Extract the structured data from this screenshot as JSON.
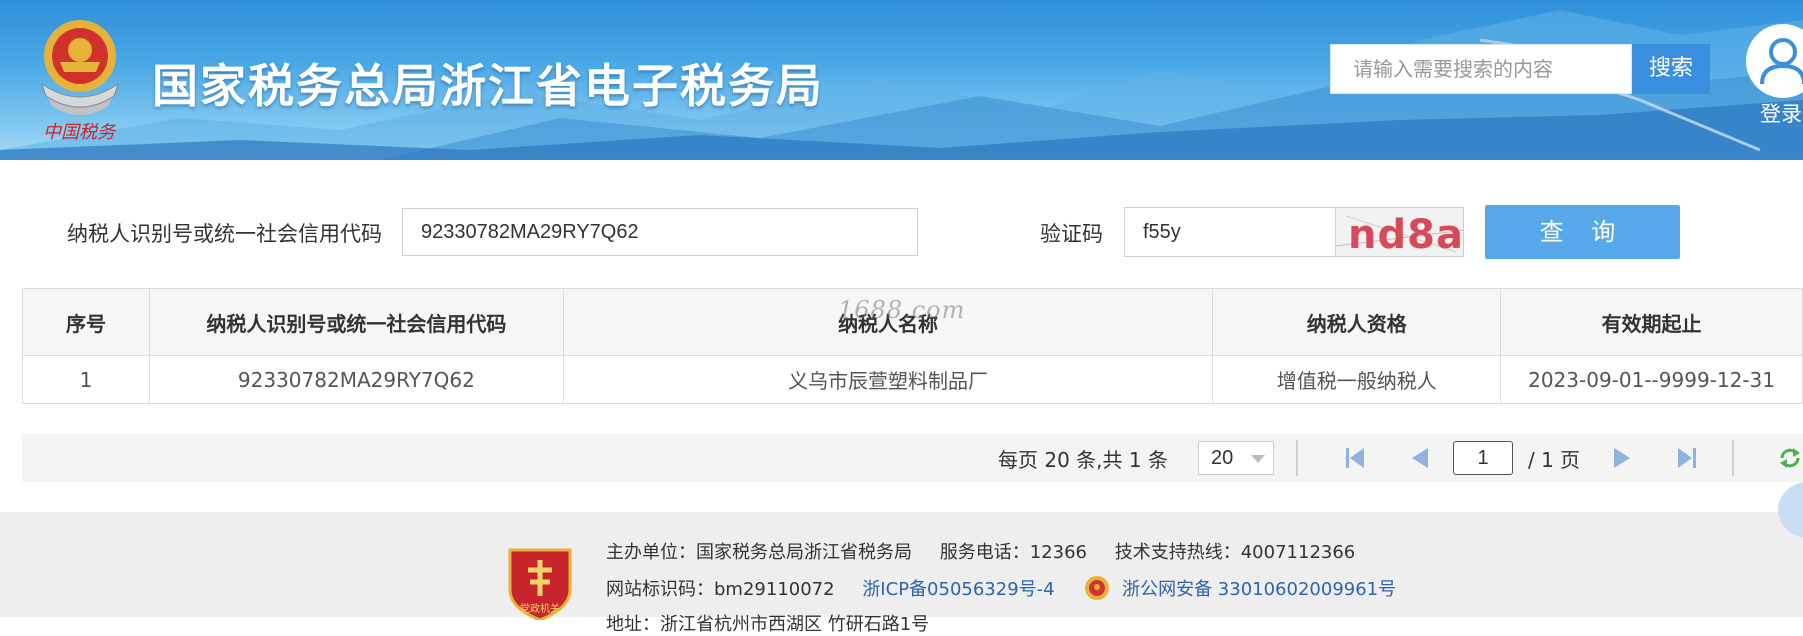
{
  "header": {
    "emblem_text": "中国税务",
    "title": "国家税务总局浙江省电子税务局",
    "search_placeholder": "请输入需要搜索的内容",
    "search_button": "搜索",
    "login_label": "登录"
  },
  "form": {
    "tin_label": "纳税人识别号或统一社会信用代码",
    "tin_value": "92330782MA29RY7Q62",
    "captcha_label": "验证码",
    "captcha_value": "f55y",
    "captcha_image_text": "nd8a",
    "query_button": "查 询"
  },
  "watermark": "1688.com",
  "table": {
    "headers": [
      "序号",
      "纳税人识别号或统一社会信用代码",
      "纳税人名称",
      "纳税人资格",
      "有效期起止"
    ],
    "rows": [
      [
        "1",
        "92330782MA29RY7Q62",
        "义乌市辰萱塑料制品厂",
        "增值税一般纳税人",
        "2023-09-01--9999-12-31"
      ]
    ]
  },
  "pager": {
    "info": "每页 20 条,共 1 条",
    "page_size": "20",
    "current_page": "1",
    "total_pages": "/ 1 页"
  },
  "footer": {
    "badge_text": "党政机关",
    "host_label": "主办单位：国家税务总局浙江省税务局",
    "phone_label": "服务电话：12366",
    "support_label": "技术支持热线：4007112366",
    "site_id_label": "网站标识码：bm29110072",
    "icp": "浙ICP备05056329号-4",
    "police": "浙公网安备 33010602009961号",
    "address_partial": "地址：浙江省杭州市西湖区 竹研石路1号"
  },
  "colors": {
    "header_blue": "#2f8fd8",
    "search_button": "#3b8fe0",
    "query_button": "#58a9ec",
    "captcha_text": "#d64a5a",
    "footer_link": "#2b64b0"
  },
  "icons": {
    "search": "magnifier",
    "user": "user-icon",
    "first": "first-page-icon",
    "prev": "prev-page-icon",
    "next": "next-page-icon",
    "last": "last-page-icon",
    "refresh": "refresh-icon"
  }
}
